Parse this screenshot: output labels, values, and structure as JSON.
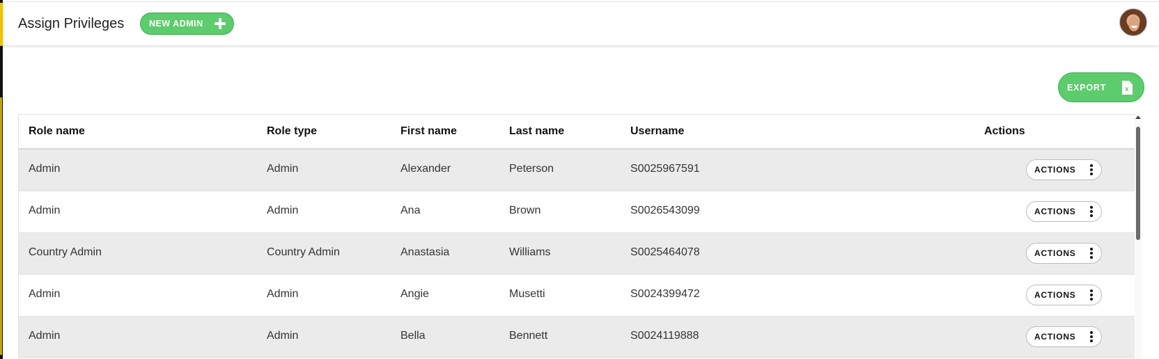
{
  "header": {
    "title": "Assign Privileges",
    "new_admin_label": "NEW ADMIN"
  },
  "toolbar": {
    "export_label": "EXPORT",
    "export_icon_glyph": "x"
  },
  "table": {
    "columns": [
      "Role name",
      "Role type",
      "First name",
      "Last name",
      "Username",
      "Actions"
    ],
    "rows": [
      {
        "role_name": "Admin",
        "role_type": "Admin",
        "first_name": "Alexander",
        "last_name": "Peterson",
        "username": "S0025967591",
        "action_label": "ACTIONS"
      },
      {
        "role_name": "Admin",
        "role_type": "Admin",
        "first_name": "Ana",
        "last_name": "Brown",
        "username": "S0026543099",
        "action_label": "ACTIONS"
      },
      {
        "role_name": "Country Admin",
        "role_type": "Country Admin",
        "first_name": "Anastasia",
        "last_name": "Williams",
        "username": "S0025464078",
        "action_label": "ACTIONS"
      },
      {
        "role_name": "Admin",
        "role_type": "Admin",
        "first_name": "Angie",
        "last_name": "Musetti",
        "username": "S0024399472",
        "action_label": "ACTIONS"
      },
      {
        "role_name": "Admin",
        "role_type": "Admin",
        "first_name": "Bella",
        "last_name": "Bennett",
        "username": "S0024119888",
        "action_label": "ACTIONS"
      }
    ]
  },
  "icons": {
    "add": "plus-icon",
    "export": "excel-file-icon",
    "row_menu": "kebab-menu-icon",
    "user": "user-avatar"
  },
  "colors": {
    "brand_green": "#5ccc6c",
    "accent_yellow": "#f5c400",
    "row_alt": "#ebebeb"
  }
}
